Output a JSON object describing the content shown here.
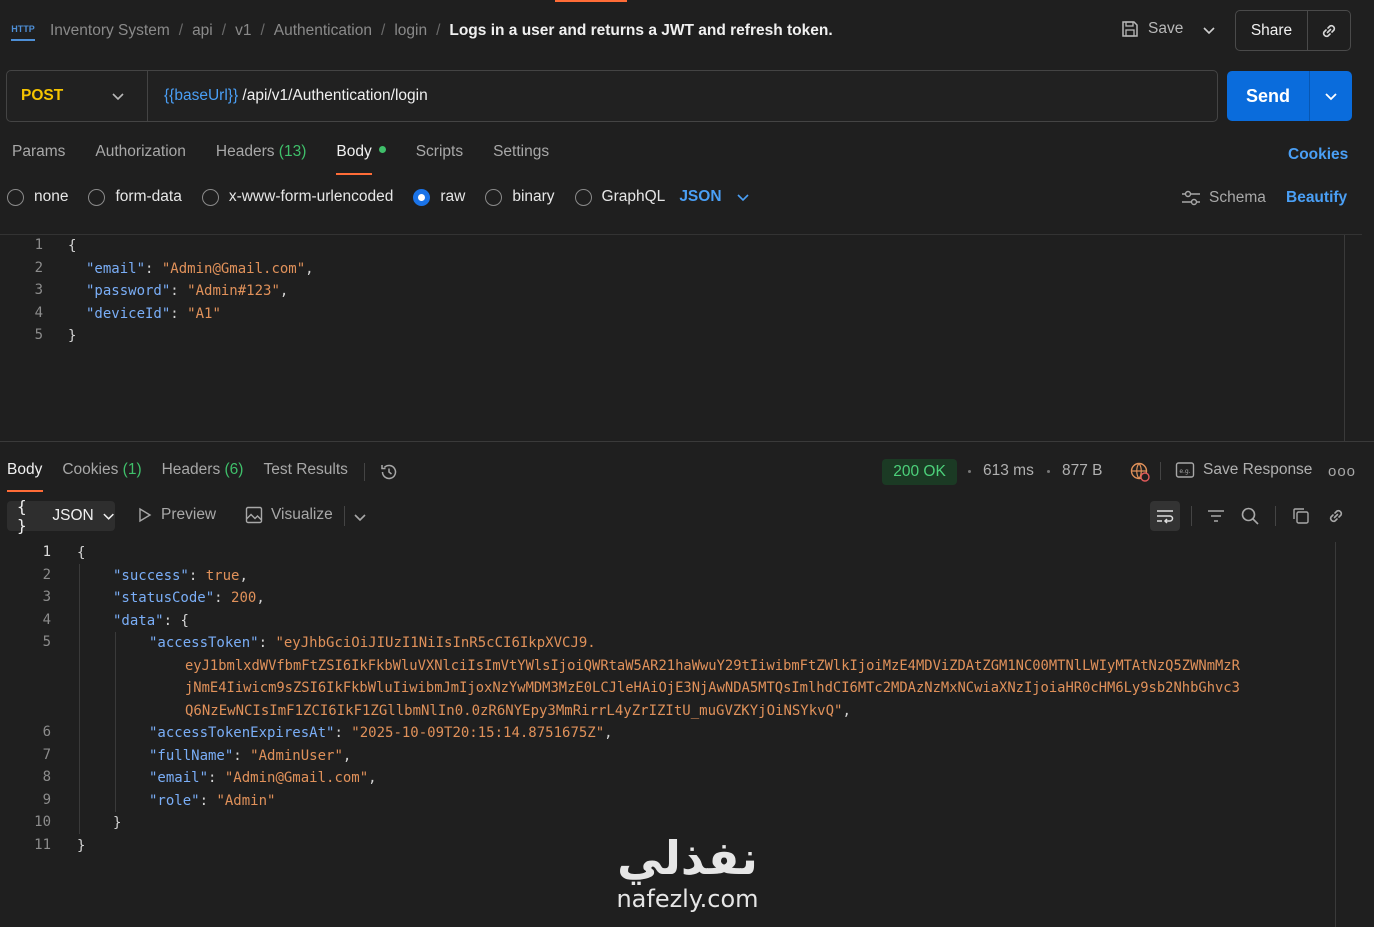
{
  "header": {
    "http_icon_label": "HTTP",
    "breadcrumb": [
      "Inventory System",
      "api",
      "v1",
      "Authentication",
      "login"
    ],
    "request_name": "Logs in a user and returns a JWT and refresh token.",
    "save_label": "Save",
    "share_label": "Share"
  },
  "request": {
    "method": "POST",
    "url_variable": "{{baseUrl}}",
    "url_path": " /api/v1/Authentication/login",
    "send_label": "Send",
    "tabs": {
      "params": "Params",
      "authorization": "Authorization",
      "headers": "Headers",
      "headers_count": "(13)",
      "body": "Body",
      "scripts": "Scripts",
      "settings": "Settings"
    },
    "cookies_label": "Cookies",
    "body_types": {
      "none": "none",
      "form_data": "form-data",
      "urlencoded": "x-www-form-urlencoded",
      "raw": "raw",
      "binary": "binary",
      "graphql": "GraphQL"
    },
    "selected_body_type": "raw",
    "raw_format": "JSON",
    "schema_label": "Schema",
    "beautify_label": "Beautify",
    "body_lines": [
      {
        "num": "1",
        "text": "{"
      },
      {
        "num": "2",
        "key": "\"email\"",
        "value": "\"Admin@Gmail.com\"",
        "end": ","
      },
      {
        "num": "3",
        "key": "\"password\"",
        "value": "\"Admin#123\"",
        "end": ","
      },
      {
        "num": "4",
        "key": "\"deviceId\"",
        "value": "\"A1\"",
        "end": ""
      },
      {
        "num": "5",
        "text": "}"
      }
    ]
  },
  "response": {
    "tabs": {
      "body": "Body",
      "cookies": "Cookies",
      "cookies_count": "(1)",
      "headers": "Headers",
      "headers_count": "(6)",
      "test_results": "Test Results"
    },
    "status": "200 OK",
    "time": "613 ms",
    "size": "877 B",
    "save_response_label": "Save Response",
    "more_label": "ooo",
    "format_label": "JSON",
    "format_icon": "{ }",
    "preview_label": "Preview",
    "visualize_label": "Visualize",
    "lines": {
      "l1": {
        "num": "1",
        "text": "{"
      },
      "l2": {
        "num": "2",
        "key": "\"success\"",
        "value": "true",
        "end": ","
      },
      "l3": {
        "num": "3",
        "key": "\"statusCode\"",
        "value": "200",
        "end": ","
      },
      "l4": {
        "num": "4",
        "key": "\"data\"",
        "value": "{"
      },
      "l5": {
        "num": "5",
        "key": "\"accessToken\"",
        "value_lines": [
          "\"eyJhbGciOiJIUzI1NiIsInR5cCI6IkpXVCJ9.",
          "eyJ1bmlxdWVfbmFtZSI6IkFkbWluVXNlciIsImVtYWlsIjoiQWRtaW5AR21haWwuY29tIiwibmFtZWlkIjoiMzE4MDViZDAtZGM1NC00MTNlLWIyMTAtNzQ5ZWNmMzR",
          "jNmE4Iiwicm9sZSI6IkFkbWluIiwibmJmIjoxNzYwMDM3MzE0LCJleHAiOjE3NjAwNDA5MTQsImlhdCI6MTc2MDAzNzMxNCwiaXNzIjoiaHR0cHM6Ly9sb2NhbGhvc3",
          "Q6NzEwNCIsImF1ZCI6IkF1ZGllbmNlIn0.0zR6NYEpy3MmRirrL4yZrIZItU_muGVZKYjOiNSYkvQ\""
        ],
        "end": ","
      },
      "l6": {
        "num": "6",
        "key": "\"accessTokenExpiresAt\"",
        "value": "\"2025-10-09T20:15:14.8751675Z\"",
        "end": ","
      },
      "l7": {
        "num": "7",
        "key": "\"fullName\"",
        "value": "\"AdminUser\"",
        "end": ","
      },
      "l8": {
        "num": "8",
        "key": "\"email\"",
        "value": "\"Admin@Gmail.com\"",
        "end": ","
      },
      "l9": {
        "num": "9",
        "key": "\"role\"",
        "value": "\"Admin\"",
        "end": ""
      },
      "l10": {
        "num": "10",
        "text": "}"
      },
      "l11": {
        "num": "11",
        "text": "}"
      }
    }
  },
  "watermark": {
    "arabic": "نفذلي",
    "latin": "nafezly.com"
  },
  "colors": {
    "accent": "#ff6c37",
    "link": "#4a9ff5",
    "send": "#0a6cdc",
    "method": "#f5c400",
    "status": "#4cd07a"
  }
}
